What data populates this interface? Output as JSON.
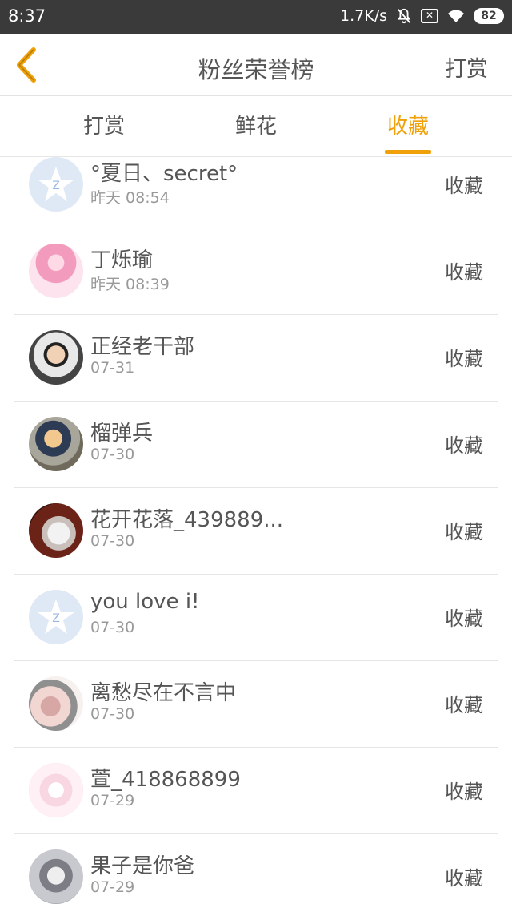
{
  "status": {
    "time": "8:37",
    "speed": "1.7K/s",
    "battery": "82"
  },
  "nav": {
    "title": "粉丝荣誉榜",
    "action": "打赏"
  },
  "tabs": [
    "打赏",
    "鲜花",
    "收藏"
  ],
  "active_tab": 2,
  "colors": {
    "accent": "#f0a10a",
    "status_bar": "#3a3a3a"
  },
  "list": [
    {
      "name": "°夏日、secret°",
      "time": "昨天 08:54",
      "tag": "收藏",
      "avatar": "default-avatar-icon"
    },
    {
      "name": "丁烁瑜",
      "time": "昨天 08:39",
      "tag": "收藏",
      "avatar": "anime-girl-avatar"
    },
    {
      "name": "正经老干部",
      "time": "07-31",
      "tag": "收藏",
      "avatar": "boy-sunglasses-avatar"
    },
    {
      "name": "榴弹兵",
      "time": "07-30",
      "tag": "收藏",
      "avatar": "soldier-avatar"
    },
    {
      "name": "花开花落_439889...",
      "time": "07-30",
      "tag": "收藏",
      "avatar": "cat-avatar"
    },
    {
      "name": "you love i!",
      "time": "07-30",
      "tag": "收藏",
      "avatar": "default-avatar-icon"
    },
    {
      "name": "离愁尽在不言中",
      "time": "07-30",
      "tag": "收藏",
      "avatar": "hand-photo-avatar"
    },
    {
      "name": "萱_418868899",
      "time": "07-29",
      "tag": "收藏",
      "avatar": "anime-girl-avatar"
    },
    {
      "name": "果子是你爸",
      "time": "07-29",
      "tag": "收藏",
      "avatar": "girl-portrait-avatar"
    }
  ]
}
